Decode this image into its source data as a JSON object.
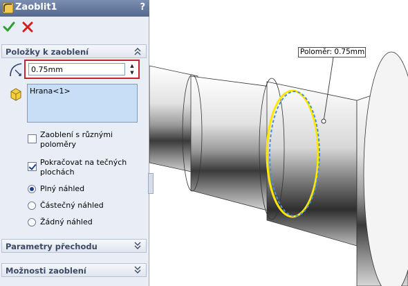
{
  "panel": {
    "title": "Zaoblit1",
    "help": "?",
    "sections": {
      "items": {
        "title": "Položky k zaoblení",
        "radius_value": "0.75mm",
        "edge_list": [
          "Hrana<1>"
        ],
        "options": {
          "variable_radius": {
            "label": "Zaoblení s různými poloměry",
            "checked": false
          },
          "tangent_propagation": {
            "label": "Pokračovat na tečných plochách",
            "checked": true
          }
        },
        "preview": {
          "full": "Plný náhled",
          "partial": "Částečný náhled",
          "none": "Žádný náhled",
          "selected": "full"
        }
      },
      "transition": {
        "title": "Parametry přechodu"
      },
      "fillet_options": {
        "title": "Možnosti zaoblení"
      }
    }
  },
  "viewport": {
    "callout": "Poloměr: 0.75mm"
  },
  "colors": {
    "title_bar": "#55698f",
    "highlight_red": "#c2242c",
    "edge_highlight": "#ffe800",
    "preview_blue": "#4a90d9"
  }
}
